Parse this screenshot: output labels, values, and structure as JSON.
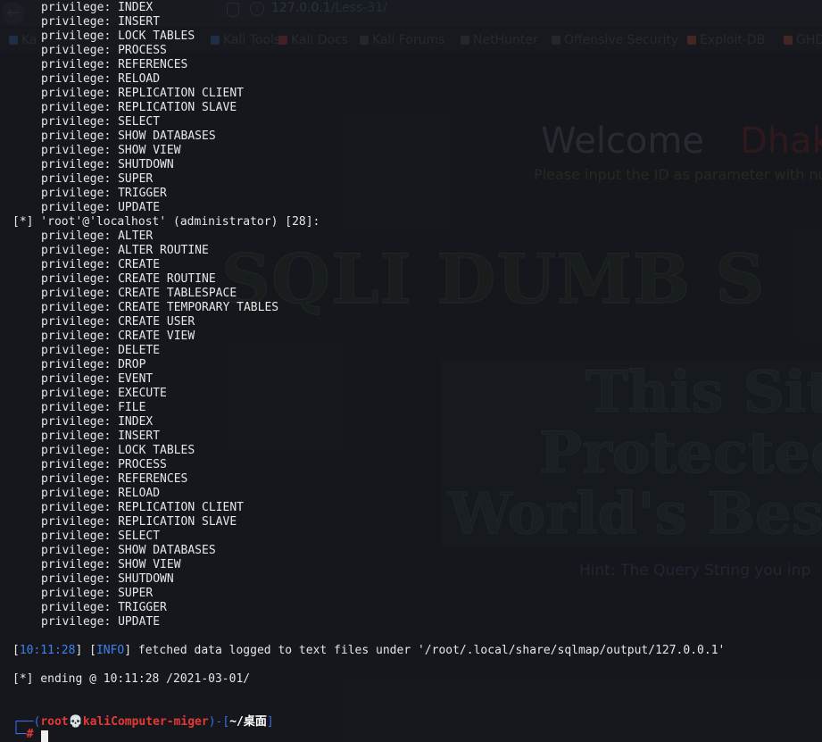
{
  "browser": {
    "url_host": "127.0.0.1",
    "url_path": "/Less-31/",
    "bookmarks": [
      {
        "label": "Ka",
        "color": "#2a4a7a"
      },
      {
        "label": "Kali Tools",
        "color": "#2a4a7a"
      },
      {
        "label": "Kali Docs",
        "color": "#7a2a2a"
      },
      {
        "label": "Kali Forums",
        "color": "#3a3a3a"
      },
      {
        "label": "NetHunter",
        "color": "#3a3a3a"
      },
      {
        "label": "Offensive Security",
        "color": "#3a3a3a"
      },
      {
        "label": "Exploit-DB",
        "color": "#7a3a2a"
      },
      {
        "label": "GHD",
        "color": "#7a3a2a"
      }
    ],
    "page": {
      "welcome": "Welcome",
      "welcome_name": "Dhak",
      "input_hint": "Please input the ID as parameter with nu",
      "banner": "SQLI DUMB S",
      "protect_line1": "This Sit",
      "protect_line2": "Protected",
      "protect_line3": "World's Best",
      "query_hint": "Hint: The Query String you inp"
    }
  },
  "terminal": {
    "privilege_prefix": "privilege: ",
    "top_privileges": [
      "INDEX",
      "INSERT",
      "LOCK TABLES",
      "PROCESS",
      "REFERENCES",
      "RELOAD",
      "REPLICATION CLIENT",
      "REPLICATION SLAVE",
      "SELECT",
      "SHOW DATABASES",
      "SHOW VIEW",
      "SHUTDOWN",
      "SUPER",
      "TRIGGER",
      "UPDATE"
    ],
    "user_header": "[*] 'root'@'localhost' (administrator) [28]:",
    "root_privileges": [
      "ALTER",
      "ALTER ROUTINE",
      "CREATE",
      "CREATE ROUTINE",
      "CREATE TABLESPACE",
      "CREATE TEMPORARY TABLES",
      "CREATE USER",
      "CREATE VIEW",
      "DELETE",
      "DROP",
      "EVENT",
      "EXECUTE",
      "FILE",
      "INDEX",
      "INSERT",
      "LOCK TABLES",
      "PROCESS",
      "REFERENCES",
      "RELOAD",
      "REPLICATION CLIENT",
      "REPLICATION SLAVE",
      "SELECT",
      "SHOW DATABASES",
      "SHOW VIEW",
      "SHUTDOWN",
      "SUPER",
      "TRIGGER",
      "UPDATE"
    ],
    "info_time": "10:11:28",
    "info_level": "INFO",
    "info_message": " fetched data logged to text files under '/root/.local/share/sqlmap/output/127.0.0.1'",
    "ending_line": "[*] ending @ 10:11:28 /2021-03-01/",
    "prompt": {
      "corner_top": "┌──(",
      "user": "root",
      "skull": "💀",
      "host": "kaliComputer-miger",
      "sep": ")-[",
      "path": "~/桌面",
      "close": "]",
      "corner_bottom": "└─",
      "symbol": "#"
    }
  },
  "colors": {
    "terminal_bg": "#15181d",
    "text": "#e6e6e6",
    "info_blue": "#3c82f0",
    "prompt_red": "#e53935",
    "prompt_blue": "#3c6ee8"
  }
}
